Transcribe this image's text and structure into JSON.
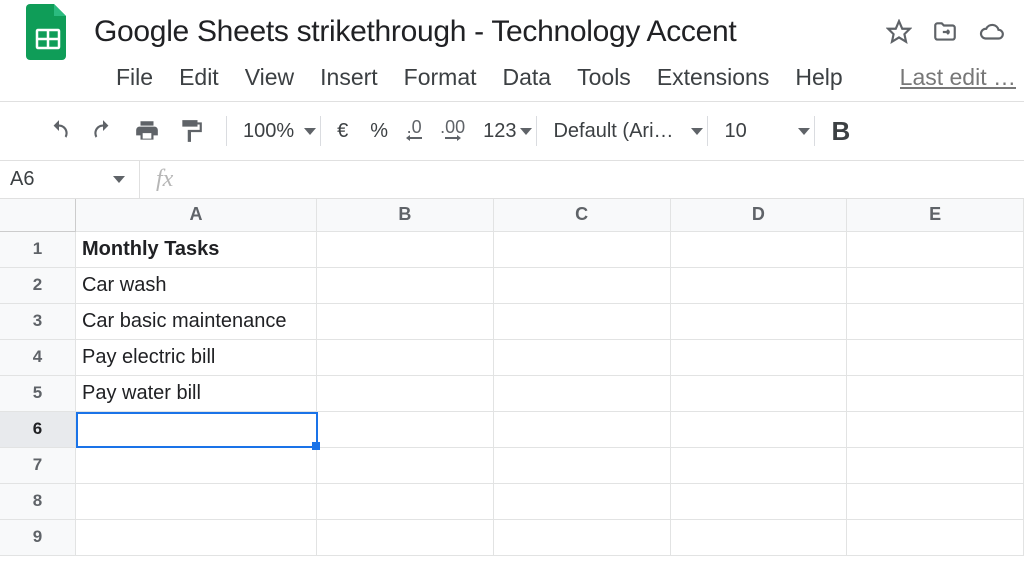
{
  "doc": {
    "title": "Google Sheets strikethrough - Technology Accent"
  },
  "menu": {
    "file": "File",
    "edit": "Edit",
    "view": "View",
    "insert": "Insert",
    "format": "Format",
    "data": "Data",
    "tools": "Tools",
    "extensions": "Extensions",
    "help": "Help",
    "last_edit": "Last edit …"
  },
  "toolbar": {
    "zoom": "100%",
    "font": "Default (Ari…",
    "font_size": "10",
    "currency_symbol": "€",
    "percent_symbol": "%",
    "dec_less": ".0",
    "dec_more": ".00",
    "more_formats": "123",
    "bold_label": "B"
  },
  "namebox": {
    "value": "A6"
  },
  "fx": {
    "label": "fx",
    "value": ""
  },
  "columns": [
    "A",
    "B",
    "C",
    "D",
    "E"
  ],
  "rows": [
    "1",
    "2",
    "3",
    "4",
    "5",
    "6",
    "7",
    "8",
    "9"
  ],
  "cells": {
    "A1": "Monthly Tasks",
    "A2": "Car wash",
    "A3": "Car basic maintenance",
    "A4": "Pay electric bill",
    "A5": "Pay water bill"
  },
  "selection": {
    "cell": "A6",
    "row_index": 5,
    "col_index": 0
  }
}
